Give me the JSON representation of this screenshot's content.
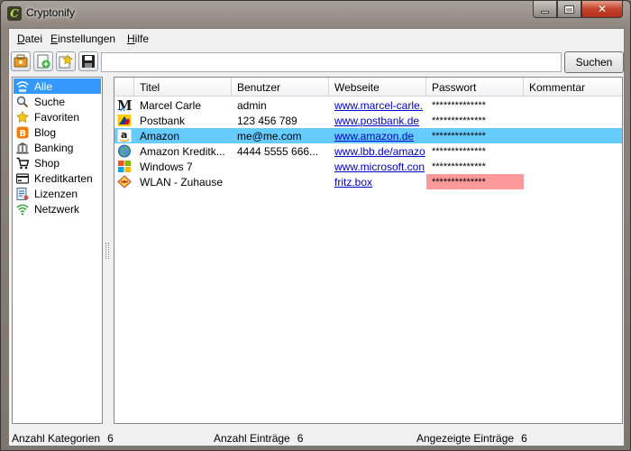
{
  "window": {
    "title": "Cryptonify"
  },
  "menu": [
    {
      "underline": "D",
      "rest": "atei"
    },
    {
      "underline": "E",
      "rest": "instellungen"
    },
    {
      "underline": "H",
      "rest": "ilfe"
    }
  ],
  "toolbar": {
    "search_value": "",
    "search_button": "Suchen"
  },
  "sidebar": {
    "items": [
      {
        "label": "Alle",
        "icon": "all-icon"
      },
      {
        "label": "Suche",
        "icon": "search-icon"
      },
      {
        "label": "Favoriten",
        "icon": "star-icon"
      },
      {
        "label": "Blog",
        "icon": "blogger-icon"
      },
      {
        "label": "Banking",
        "icon": "bank-icon"
      },
      {
        "label": "Shop",
        "icon": "cart-icon"
      },
      {
        "label": "Kreditkarten",
        "icon": "credit-card-icon"
      },
      {
        "label": "Lizenzen",
        "icon": "license-icon"
      },
      {
        "label": "Netzwerk",
        "icon": "wifi-icon"
      }
    ],
    "selected_index": 0
  },
  "table": {
    "columns": [
      "",
      "Titel",
      "Benutzer",
      "Webseite",
      "Passwort",
      "Kommentar"
    ],
    "rows": [
      {
        "icon": "m-logo-icon",
        "title": "Marcel Carle",
        "user": "admin",
        "website": "www.marcel-carle.",
        "password": "**************",
        "comment": ""
      },
      {
        "icon": "postbank-icon",
        "title": "Postbank",
        "user": "123 456 789",
        "website": "www.postbank.de",
        "password": "**************",
        "comment": ""
      },
      {
        "icon": "amazon-icon",
        "title": "Amazon",
        "user": "me@me.com",
        "website": "www.amazon.de",
        "password": "**************",
        "comment": ""
      },
      {
        "icon": "globe-icon",
        "title": "Amazon Kreditk...",
        "user": "4444 5555 666...",
        "website": "www.lbb.de/amazo",
        "password": "**************",
        "comment": ""
      },
      {
        "icon": "windows-icon",
        "title": "Windows 7",
        "user": "",
        "website": "www.microsoft.con",
        "password": "**************",
        "comment": ""
      },
      {
        "icon": "wlan-icon",
        "title": "WLAN - Zuhause",
        "user": "",
        "website": "fritz.box",
        "password": "**************",
        "comment": ""
      }
    ],
    "selected_row": 2,
    "weak_password_row": 5
  },
  "status": {
    "categories_label": "Anzahl Kategorien",
    "categories_value": "6",
    "entries_label": "Anzahl Einträge",
    "entries_value": "6",
    "shown_label": "Angezeigte Einträge",
    "shown_value": "6"
  },
  "colors": {
    "selection": "#3399ff",
    "row_selection": "#66ccff",
    "weak_password": "#ff9a9a",
    "link": "#0000cc"
  }
}
